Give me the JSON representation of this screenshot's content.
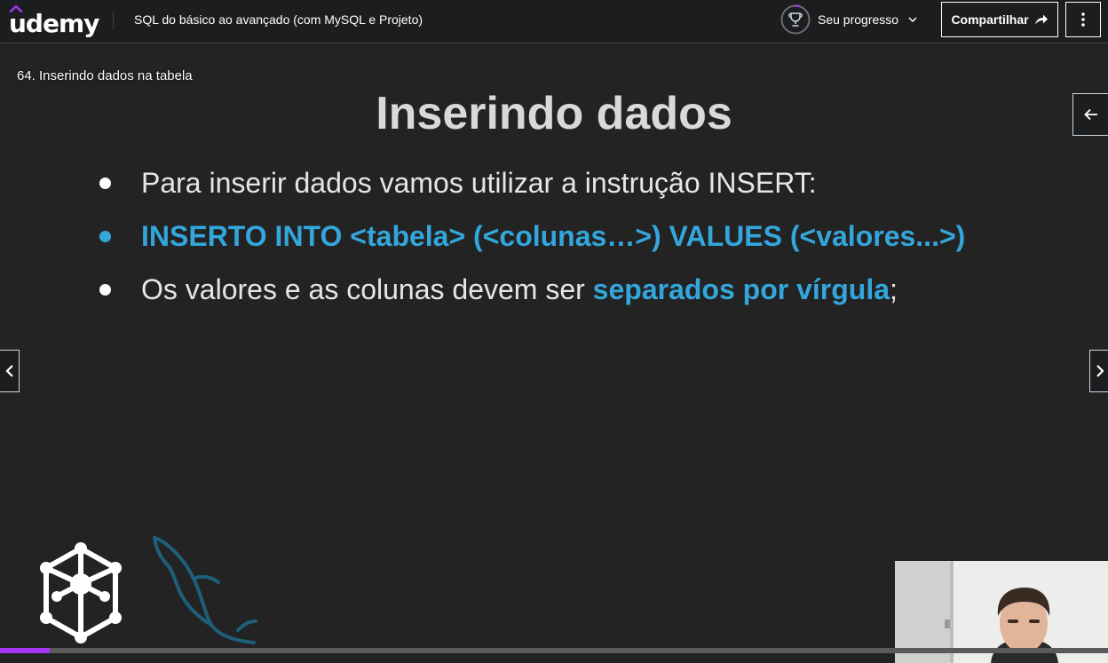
{
  "header": {
    "logo_text": "udemy",
    "course_title": "SQL do básico ao avançado (com MySQL e Projeto)",
    "progress_label": "Seu progresso",
    "share_label": "Compartilhar"
  },
  "video": {
    "lecture_title": "64. Inserindo dados na tabela",
    "slide": {
      "heading": "Inserindo dados",
      "bullet1": "Para inserir dados vamos utilizar a instrução INSERT:",
      "bullet2": "INSERTO INTO <tabela> (<colunas…>) VALUES (<valores...>)",
      "bullet3_part1": "Os valores e as colunas devem ser ",
      "bullet3_highlight": "separados por vírgula",
      "bullet3_part2": ";"
    },
    "playback_progress": 0.045
  },
  "colors": {
    "accent_purple": "#a435f0",
    "slide_highlight": "#33a6dc",
    "background": "#1c1d1f"
  },
  "icons": {
    "trophy": "trophy-icon",
    "chevron": "chevron-down-icon",
    "share": "share-arrow-icon",
    "more": "more-vertical-icon",
    "prev": "chevron-left-icon",
    "next": "chevron-right-icon",
    "sidebar": "arrow-left-icon"
  }
}
